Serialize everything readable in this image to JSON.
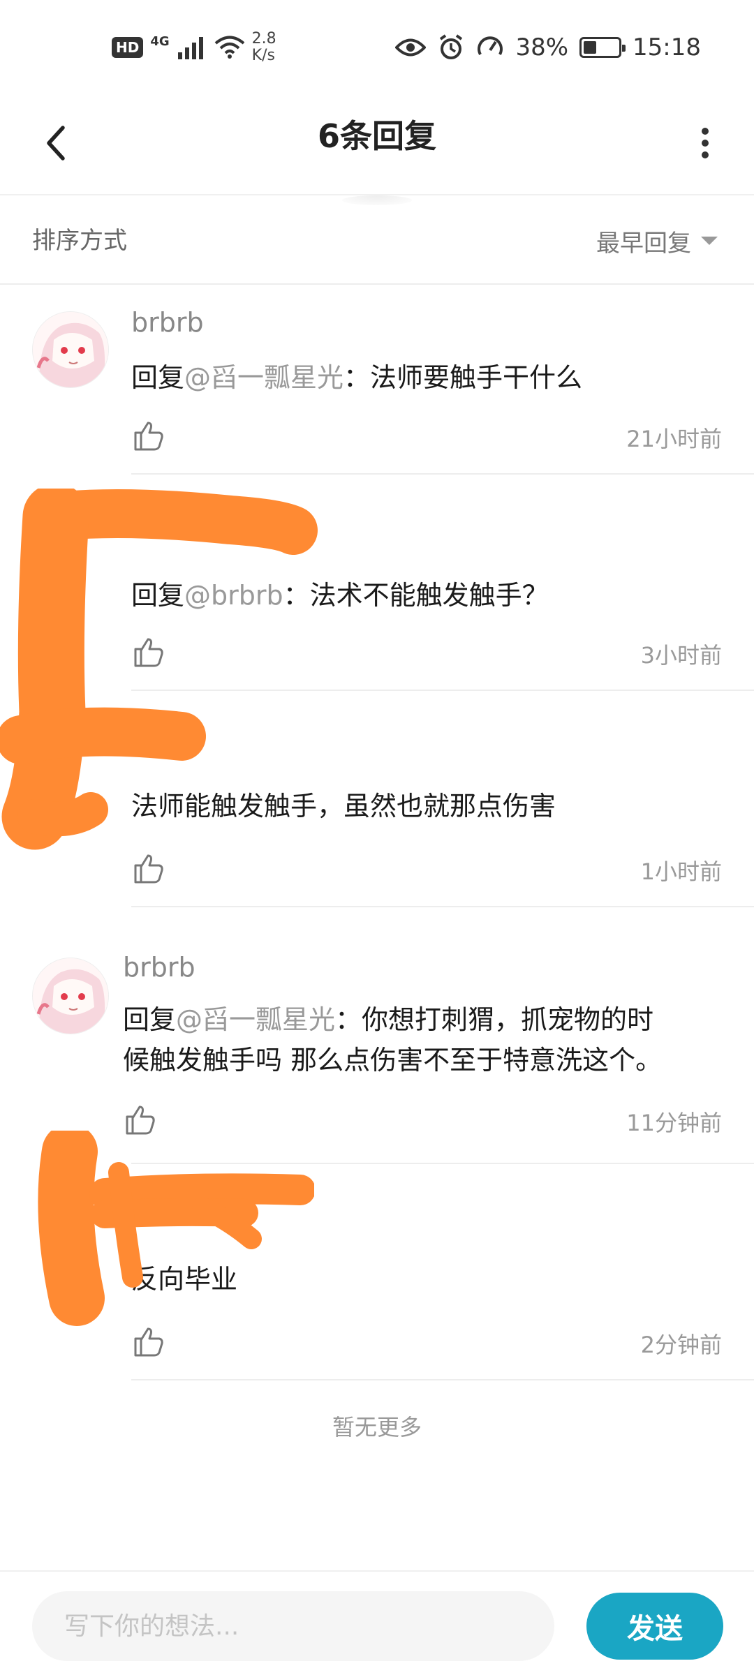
{
  "status_bar": {
    "hd": "HD",
    "network": "4G",
    "speed_value": "2.8",
    "speed_unit": "K/s",
    "battery": "38%",
    "battery_level": 0.38,
    "time": "15:18"
  },
  "header": {
    "title": "6条回复"
  },
  "sort": {
    "label": "排序方式",
    "selected": "最早回复"
  },
  "comments": [
    {
      "username": "brbrb",
      "reply_prefix": "回复",
      "mention": "@舀一瓢星光",
      "separator": "：",
      "text": "法师要触手干什么",
      "time": "21小时前"
    },
    {
      "reply_prefix": "回复",
      "mention": "@brbrb",
      "separator": "：",
      "text": "法术不能触发触手？",
      "time": "3小时前"
    },
    {
      "text": "法师能触发触手，虽然也就那点伤害",
      "time": "1小时前"
    },
    {
      "username": "brbrb",
      "reply_prefix": "回复",
      "mention": "@舀一瓢星光",
      "separator": "：",
      "text_line1": "你想打刺猬，抓宠物的时",
      "text_line2": "候触发触手吗 那么点伤害不至于特意洗这个。",
      "time": "11分钟前"
    },
    {
      "text": "反向毕业",
      "time": "2分钟前"
    }
  ],
  "footer_note": "暂无更多",
  "input": {
    "placeholder": "写下你的想法...",
    "send_label": "发送"
  },
  "colors": {
    "accent": "#1aa6c4",
    "censor": "#ff8a33"
  }
}
